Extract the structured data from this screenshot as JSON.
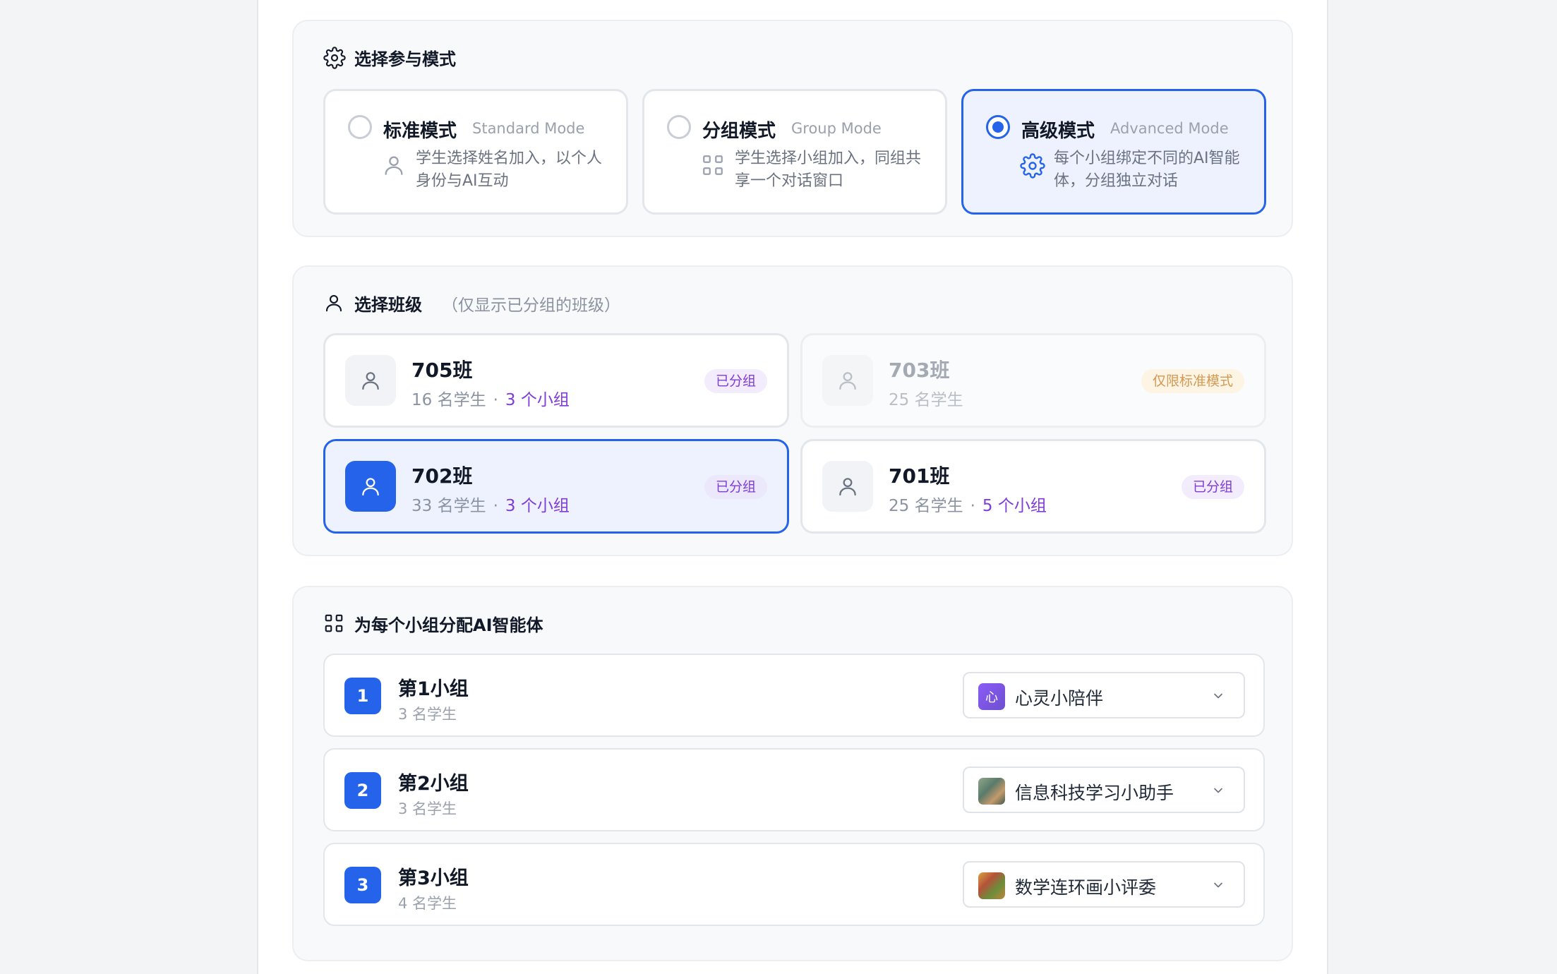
{
  "mode_section": {
    "title": "选择参与模式",
    "modes": [
      {
        "name": "标准模式",
        "en": "Standard Mode",
        "desc": "学生选择姓名加入，以个人身份与AI互动",
        "icon": "user-icon",
        "selected": false
      },
      {
        "name": "分组模式",
        "en": "Group Mode",
        "desc": "学生选择小组加入，同组共享一个对话窗口",
        "icon": "group-grid-icon",
        "selected": false
      },
      {
        "name": "高级模式",
        "en": "Advanced Mode",
        "desc": "每个小组绑定不同的AI智能体，分组独立对话",
        "icon": "gear-icon",
        "selected": true
      }
    ]
  },
  "class_section": {
    "title": "选择班级",
    "note": "（仅显示已分组的班级）",
    "classes": [
      {
        "name": "705班",
        "students": "16 名学生",
        "groups": "3 个小组",
        "badge": "已分组",
        "state": "normal"
      },
      {
        "name": "703班",
        "students": "25 名学生",
        "groups": "",
        "badge": "仅限标准模式",
        "state": "disabled"
      },
      {
        "name": "702班",
        "students": "33 名学生",
        "groups": "3 个小组",
        "badge": "已分组",
        "state": "selected"
      },
      {
        "name": "701班",
        "students": "25 名学生",
        "groups": "5 个小组",
        "badge": "已分组",
        "state": "normal"
      }
    ],
    "separator": "·"
  },
  "agent_section": {
    "title": "为每个小组分配AI智能体",
    "groups": [
      {
        "num": "1",
        "name": "第1小组",
        "count": "3 名学生",
        "agent": "心灵小陪伴",
        "agent_avatar_text": "心",
        "agent_color": "#7c5cd6"
      },
      {
        "num": "2",
        "name": "第2小组",
        "count": "3 名学生",
        "agent": "信息科技学习小助手",
        "agent_avatar_text": "",
        "agent_color": "#5a7a6a"
      },
      {
        "num": "3",
        "name": "第3小组",
        "count": "4 名学生",
        "agent": "数学连环画小评委",
        "agent_avatar_text": "",
        "agent_color": "#c0843c"
      }
    ]
  },
  "colors": {
    "accent": "#2563eb",
    "purple": "#7e3cd8",
    "warn": "#d29a54"
  }
}
